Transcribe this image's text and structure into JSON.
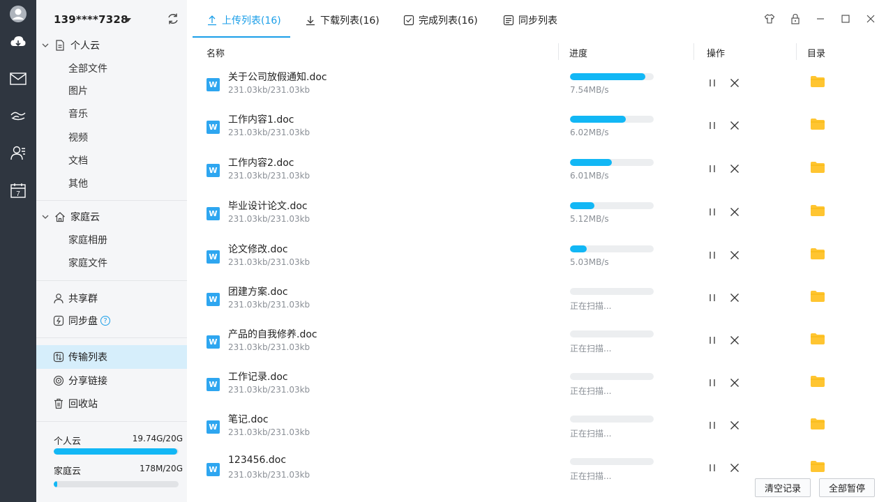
{
  "rail": {
    "items": [
      "avatar-icon",
      "cloud-icon",
      "mail-icon",
      "cloud-drive-icon",
      "contacts-icon",
      "calendar-icon"
    ],
    "calendar_day": "7"
  },
  "sidebar": {
    "account": "139****7328",
    "personal": {
      "label": "个人云",
      "items": [
        "全部文件",
        "图片",
        "音乐",
        "视频",
        "文档",
        "其他"
      ]
    },
    "family": {
      "label": "家庭云",
      "items": [
        "家庭相册",
        "家庭文件"
      ]
    },
    "shared_group": "共享群",
    "sync_disk": "同步盘",
    "help_mark": "?",
    "transfer_list": "传输列表",
    "share_links": "分享链接",
    "recycle_bin": "回收站",
    "quota": {
      "personal_label": "个人云",
      "personal_value": "19.74G/20G",
      "personal_fraction": 0.987,
      "family_label": "家庭云",
      "family_value": "178M/20G",
      "family_fraction": 0.009
    }
  },
  "tabs": [
    {
      "label": "上传列表(16)",
      "icon": "upload-icon",
      "active": true
    },
    {
      "label": "下载列表(16)",
      "icon": "download-icon",
      "active": false
    },
    {
      "label": "完成列表(16)",
      "icon": "checkbox-icon",
      "active": false
    },
    {
      "label": "同步列表",
      "icon": "sync-list-icon",
      "active": false
    }
  ],
  "columns": {
    "name": "名称",
    "progress": "进度",
    "action": "操作",
    "directory": "目录"
  },
  "files": [
    {
      "name": "关于公司放假通知.doc",
      "size": "231.03kb/231.03kb",
      "progress": 0.9,
      "status": "7.54MB/s"
    },
    {
      "name": "工作内容1.doc",
      "size": "231.03kb/231.03kb",
      "progress": 0.67,
      "status": "6.02MB/s"
    },
    {
      "name": "工作内容2.doc",
      "size": "231.03kb/231.03kb",
      "progress": 0.5,
      "status": "6.01MB/s"
    },
    {
      "name": "毕业设计论文.doc",
      "size": "231.03kb/231.03kb",
      "progress": 0.29,
      "status": "5.12MB/s"
    },
    {
      "name": "论文修改.doc",
      "size": "231.03kb/231.03kb",
      "progress": 0.2,
      "status": "5.03MB/s"
    },
    {
      "name": "团建方案.doc",
      "size": "231.03kb/231.03kb",
      "progress": 0,
      "status": "正在扫描..."
    },
    {
      "name": "产品的自我修养.doc",
      "size": "231.03kb/231.03kb",
      "progress": 0,
      "status": "正在扫描..."
    },
    {
      "name": "工作记录.doc",
      "size": "231.03kb/231.03kb",
      "progress": 0,
      "status": "正在扫描..."
    },
    {
      "name": "笔记.doc",
      "size": "231.03kb/231.03kb",
      "progress": 0,
      "status": "正在扫描..."
    },
    {
      "name": "123456.doc",
      "size": "231.03kb/231.03kb",
      "progress": 0,
      "status": "正在扫描..."
    }
  ],
  "file_icon_letter": "W",
  "footer": {
    "clear_label": "清空记录",
    "pause_all_label": "全部暂停"
  },
  "colors": {
    "accent": "#1a9ee8",
    "progress": "#12b7f5",
    "rail": "#2f3640",
    "folder": "#ffc531"
  }
}
